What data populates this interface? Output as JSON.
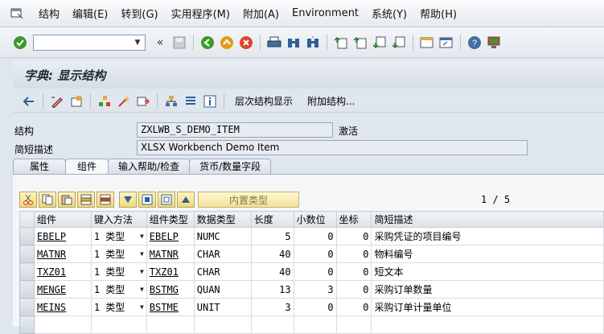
{
  "menu": {
    "items": [
      "结构",
      "编辑(E)",
      "转到(G)",
      "实用程序(M)",
      "附加(A)",
      "Environment",
      "系统(Y)",
      "帮助(H)"
    ]
  },
  "title": "字典: 显示结构",
  "app_toolbar": {
    "hierarchy_label": "层次结构显示",
    "append_label": "附加结构..."
  },
  "fields": {
    "structure_label": "结构",
    "structure_value": "ZXLWB_S_DEMO_ITEM",
    "status": "激活",
    "desc_label": "简短描述",
    "desc_value": "XLSX Workbench Demo Item"
  },
  "tabs": [
    "属性",
    "组件",
    "输入帮助/检查",
    "货币/数量字段"
  ],
  "active_tab": 1,
  "table_toolbar": {
    "builtin_type_label": "内置类型",
    "pager": "1 / 5"
  },
  "table": {
    "columns": [
      "组件",
      "键入方法",
      "组件类型",
      "数据类型",
      "长度",
      "小数位",
      "坐标",
      "简短描述"
    ],
    "rows": [
      {
        "component": "EBELP",
        "method": "1 类型",
        "type": "EBELP",
        "dtype": "NUMC",
        "length": "5",
        "decimals": "0",
        "coord": "0",
        "desc": "采购凭证的项目编号"
      },
      {
        "component": "MATNR",
        "method": "1 类型",
        "type": "MATNR",
        "dtype": "CHAR",
        "length": "40",
        "decimals": "0",
        "coord": "0",
        "desc": "物料编号"
      },
      {
        "component": "TXZ01",
        "method": "1 类型",
        "type": "TXZ01",
        "dtype": "CHAR",
        "length": "40",
        "decimals": "0",
        "coord": "0",
        "desc": "短文本"
      },
      {
        "component": "MENGE",
        "method": "1 类型",
        "type": "BSTMG",
        "dtype": "QUAN",
        "length": "13",
        "decimals": "3",
        "coord": "0",
        "desc": "采购订单数量"
      },
      {
        "component": "MEINS",
        "method": "1 类型",
        "type": "BSTME",
        "dtype": "UNIT",
        "length": "3",
        "decimals": "0",
        "coord": "0",
        "desc": "采购订单计量单位"
      }
    ]
  },
  "colors": {
    "accent_green": "#3a9a2a",
    "cancel_red": "#d9472b",
    "exit_orange": "#e39a1e",
    "link_blue": "#1f4f8f"
  }
}
